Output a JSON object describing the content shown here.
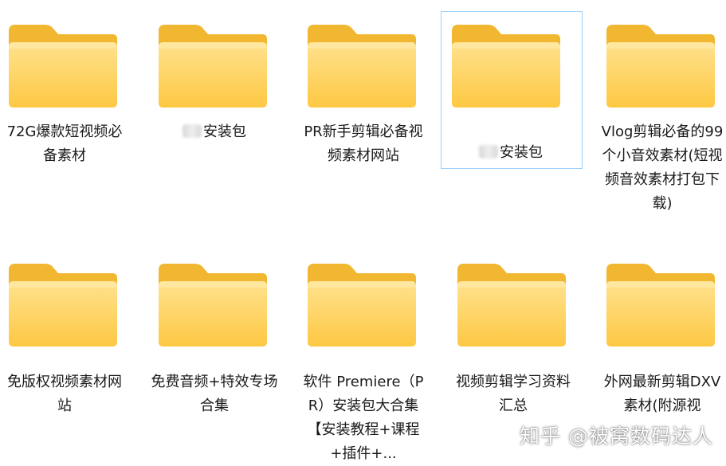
{
  "folders": [
    {
      "label": "72G爆款短视频必备素材",
      "redacted": false
    },
    {
      "label": "安装包",
      "redacted": true
    },
    {
      "label": "PR新手剪辑必备视频素材网站",
      "redacted": false
    },
    {
      "label": "安装包",
      "redacted": true,
      "selected": true
    },
    {
      "label": "Vlog剪辑必备的99个小音效素材(短视频音效素材打包下载)",
      "redacted": false
    },
    {
      "label": "免版权视频素材网站",
      "redacted": false
    },
    {
      "label": "免费音频+特效专场合集",
      "redacted": false
    },
    {
      "label": "软件 Premiere（PR）安装包大合集【安装教程+课程+插件+...",
      "redacted": false
    },
    {
      "label": "视频剪辑学习资料汇总",
      "redacted": false
    },
    {
      "label": "外网最新剪辑DXV素材(附源视",
      "redacted": false
    }
  ],
  "watermark": "知乎 @被窝数码达人",
  "colors": {
    "folder_back": "#f1b731",
    "folder_front_top": "#ffe28e",
    "folder_front_bottom": "#fdc843",
    "selection_border": "#99d1ff"
  },
  "icons": {
    "folder": "folder-icon"
  }
}
